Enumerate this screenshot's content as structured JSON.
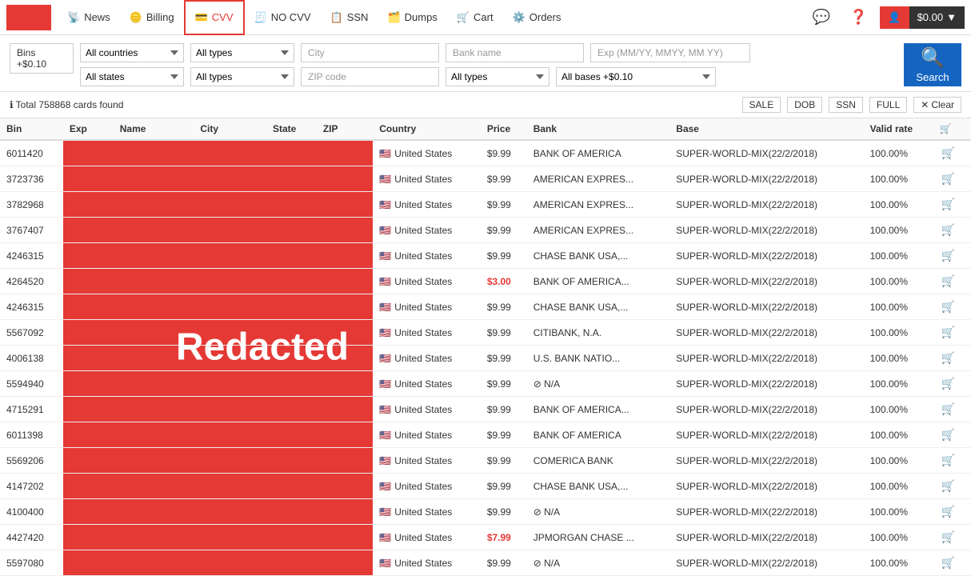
{
  "nav": {
    "logo_bg": "#e53935",
    "items": [
      {
        "label": "News",
        "icon": "📡",
        "active": false,
        "name": "nav-news"
      },
      {
        "label": "Billing",
        "icon": "💳",
        "active": false,
        "name": "nav-billing"
      },
      {
        "label": "CVV",
        "icon": "💳",
        "active": true,
        "name": "nav-cvv"
      },
      {
        "label": "NO CVV",
        "icon": "🧾",
        "active": false,
        "name": "nav-nocvv"
      },
      {
        "label": "SSN",
        "icon": "📋",
        "active": false,
        "name": "nav-ssn"
      },
      {
        "label": "Dumps",
        "icon": "🗂️",
        "active": false,
        "name": "nav-dumps"
      },
      {
        "label": "Cart",
        "icon": "🛒",
        "active": false,
        "name": "nav-cart"
      },
      {
        "label": "Orders",
        "icon": "⚙️",
        "active": false,
        "name": "nav-orders"
      }
    ],
    "balance": "$0.00",
    "balance_label": "$0.00"
  },
  "filters": {
    "bins_label": "Bins",
    "bins_sublabel": "+$0.10",
    "countries_placeholder": "All countries",
    "types1_placeholder": "All types",
    "city_placeholder": "City",
    "bank_placeholder": "Bank name",
    "exp_placeholder": "Exp (MM/YY, MMYY, MM YY)",
    "states_placeholder": "All states",
    "types2_placeholder": "All types",
    "zip_placeholder": "ZIP code",
    "types3_placeholder": "All types",
    "bases_placeholder": "All bases +$0.10",
    "search_label": "Search"
  },
  "results": {
    "count_text": "ℹ Total 758868 cards found",
    "tags": [
      "SALE",
      "DOB",
      "SSN",
      "FULL"
    ],
    "clear_label": "✕ Clear"
  },
  "table": {
    "headers": [
      "Bin",
      "Exp",
      "Name",
      "City",
      "State",
      "ZIP",
      "Country",
      "Price",
      "Bank",
      "Base",
      "Valid rate",
      ""
    ],
    "rows": [
      {
        "bin": "6011420",
        "exp": "",
        "name": "",
        "city": "",
        "state": "",
        "zip": "",
        "country": "United States",
        "price": "$9.99",
        "price_red": false,
        "bank": "BANK OF AMERICA",
        "base": "SUPER-WORLD-MIX(22/2/2018)",
        "valid_rate": "100.00%"
      },
      {
        "bin": "3723736",
        "exp": "",
        "name": "",
        "city": "",
        "state": "",
        "zip": "",
        "country": "United States",
        "price": "$9.99",
        "price_red": false,
        "bank": "AMERICAN EXPRES...",
        "base": "SUPER-WORLD-MIX(22/2/2018)",
        "valid_rate": "100.00%"
      },
      {
        "bin": "3782968",
        "exp": "",
        "name": "",
        "city": "",
        "state": "",
        "zip": "",
        "country": "United States",
        "price": "$9.99",
        "price_red": false,
        "bank": "AMERICAN EXPRES...",
        "base": "SUPER-WORLD-MIX(22/2/2018)",
        "valid_rate": "100.00%"
      },
      {
        "bin": "3767407",
        "exp": "",
        "name": "",
        "city": "",
        "state": "",
        "zip": "",
        "country": "United States",
        "price": "$9.99",
        "price_red": false,
        "bank": "AMERICAN EXPRES...",
        "base": "SUPER-WORLD-MIX(22/2/2018)",
        "valid_rate": "100.00%"
      },
      {
        "bin": "4246315",
        "exp": "",
        "name": "",
        "city": "",
        "state": "",
        "zip": "",
        "country": "United States",
        "price": "$9.99",
        "price_red": false,
        "bank": "CHASE BANK USA,...",
        "base": "SUPER-WORLD-MIX(22/2/2018)",
        "valid_rate": "100.00%"
      },
      {
        "bin": "4264520",
        "exp": "",
        "name": "",
        "city": "",
        "state": "",
        "zip": "",
        "country": "United States",
        "price": "$3.00",
        "price_red": true,
        "bank": "BANK OF AMERICA...",
        "base": "SUPER-WORLD-MIX(22/2/2018)",
        "valid_rate": "100.00%"
      },
      {
        "bin": "4246315",
        "exp": "",
        "name": "",
        "city": "",
        "state": "",
        "zip": "",
        "country": "United States",
        "price": "$9.99",
        "price_red": false,
        "bank": "CHASE BANK USA,...",
        "base": "SUPER-WORLD-MIX(22/2/2018)",
        "valid_rate": "100.00%"
      },
      {
        "bin": "5567092",
        "exp": "",
        "name": "",
        "city": "",
        "state": "",
        "zip": "",
        "country": "United States",
        "price": "$9.99",
        "price_red": false,
        "bank": "CITIBANK, N.A.",
        "base": "SUPER-WORLD-MIX(22/2/2018)",
        "valid_rate": "100.00%"
      },
      {
        "bin": "4006138",
        "exp": "",
        "name": "",
        "city": "",
        "state": "",
        "zip": "",
        "country": "United States",
        "price": "$9.99",
        "price_red": false,
        "bank": "U.S. BANK NATIO...",
        "base": "SUPER-WORLD-MIX(22/2/2018)",
        "valid_rate": "100.00%"
      },
      {
        "bin": "5594940",
        "exp": "",
        "name": "",
        "city": "",
        "state": "",
        "zip": "",
        "country": "United States",
        "price": "$9.99",
        "price_red": false,
        "bank": "⊘ N/A",
        "base": "SUPER-WORLD-MIX(22/2/2018)",
        "valid_rate": "100.00%"
      },
      {
        "bin": "4715291",
        "exp": "",
        "name": "",
        "city": "",
        "state": "",
        "zip": "",
        "country": "United States",
        "price": "$9.99",
        "price_red": false,
        "bank": "BANK OF AMERICA...",
        "base": "SUPER-WORLD-MIX(22/2/2018)",
        "valid_rate": "100.00%"
      },
      {
        "bin": "6011398",
        "exp": "",
        "name": "",
        "city": "",
        "state": "",
        "zip": "",
        "country": "United States",
        "price": "$9.99",
        "price_red": false,
        "bank": "BANK OF AMERICA",
        "base": "SUPER-WORLD-MIX(22/2/2018)",
        "valid_rate": "100.00%"
      },
      {
        "bin": "5569206",
        "exp": "",
        "name": "",
        "city": "",
        "state": "",
        "zip": "",
        "country": "United States",
        "price": "$9.99",
        "price_red": false,
        "bank": "COMERICA BANK",
        "base": "SUPER-WORLD-MIX(22/2/2018)",
        "valid_rate": "100.00%"
      },
      {
        "bin": "4147202",
        "exp": "",
        "name": "",
        "city": "",
        "state": "",
        "zip": "",
        "country": "United States",
        "price": "$9.99",
        "price_red": false,
        "bank": "CHASE BANK USA,...",
        "base": "SUPER-WORLD-MIX(22/2/2018)",
        "valid_rate": "100.00%"
      },
      {
        "bin": "4100400",
        "exp": "",
        "name": "",
        "city": "",
        "state": "",
        "zip": "",
        "country": "United States",
        "price": "$9.99",
        "price_red": false,
        "bank": "⊘ N/A",
        "base": "SUPER-WORLD-MIX(22/2/2018)",
        "valid_rate": "100.00%"
      },
      {
        "bin": "4427420",
        "exp": "",
        "name": "",
        "city": "",
        "state": "",
        "zip": "",
        "country": "United States",
        "price": "$7.99",
        "price_red": true,
        "bank": "JPMORGAN CHASE ...",
        "base": "SUPER-WORLD-MIX(22/2/2018)",
        "valid_rate": "100.00%"
      },
      {
        "bin": "5597080",
        "exp": "",
        "name": "",
        "city": "",
        "state": "",
        "zip": "",
        "country": "United States",
        "price": "$9.99",
        "price_red": false,
        "bank": "⊘ N/A",
        "base": "SUPER-WORLD-MIX(22/2/2018)",
        "valid_rate": "100.00%"
      }
    ]
  },
  "redacted_label": "Redacted"
}
